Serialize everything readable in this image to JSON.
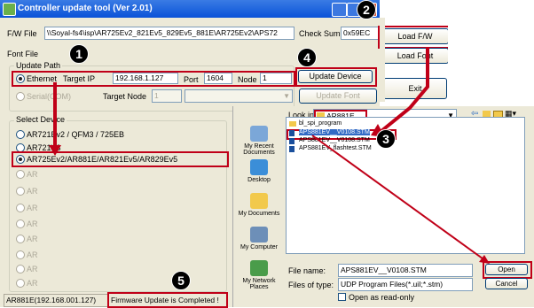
{
  "window": {
    "title": "Controller update tool  (Ver 2.01)",
    "fw_file_label": "F/W File",
    "fw_file_value": "\\\\Soyal-fs4\\isp\\AR725Ev2_821Ev5_829Ev5_881E\\AR725Ev2\\APS72",
    "checksum_label": "Check Sum",
    "checksum_value": "0x59EC",
    "font_file_label": "Font File",
    "load_fw_button": "Load F/W",
    "load_font_button": "Load Font",
    "update_device_button": "Update Device",
    "update_font_button": "Update Font",
    "exit_button": "Exit",
    "update_path_label": "Update Path",
    "ethernet_label": "Ethernet",
    "target_ip_label": "Target IP",
    "target_ip_value": "192.168.1.127",
    "port_label": "Port",
    "port_value": "1604",
    "node_label": "Node",
    "node_value": "1",
    "serial_label": "Serial(COM)",
    "target_node_label": "Target Node",
    "target_node_value": "1",
    "select_device_label": "Select Device",
    "devices": [
      "AR721Ev2 / QFM3 / 725EB",
      "AR721V3",
      "AR725Ev2/AR881E/AR821Ev5/AR829Ev5",
      "AR",
      "AR",
      "AR",
      "AR",
      "AR",
      "AR",
      "AR",
      "AR",
      "AR"
    ],
    "status_left": "AR881E(192.168.001.127)",
    "status_right": "Firmware Update is Completed !"
  },
  "dialog": {
    "look_in_label": "Look in:",
    "look_in_value": "AR881E",
    "places": [
      "My Recent Documents",
      "Desktop",
      "My Documents",
      "My Computer",
      "My Network Places"
    ],
    "files": [
      "bl_spi_program",
      "APS881EV__V0108.STM",
      "APS881EV__V0108.STM",
      "APS881EV_flashtest.STM"
    ],
    "file_name_label": "File name:",
    "file_name_value": "APS881EV__V0108.STM",
    "file_type_label": "Files of type:",
    "file_type_value": "UDP Program Files(*.uiI;*.stm)",
    "read_only_label": "Open as read-only",
    "open_button": "Open",
    "cancel_button": "Cancel"
  },
  "steps": [
    "1",
    "2",
    "3",
    "4",
    "5"
  ],
  "colors": {
    "highlight": "#c00018",
    "titlebar": "#0a52d8"
  }
}
